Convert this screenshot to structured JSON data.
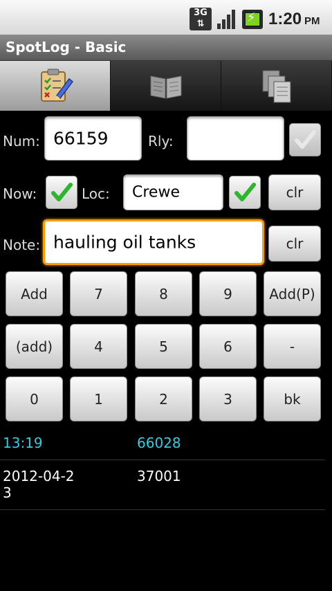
{
  "status_bar": {
    "network": "3G",
    "time": "1:20",
    "ampm": "PM",
    "icons": [
      "3g-data-icon",
      "signal-strength-icon",
      "battery-charging-icon"
    ]
  },
  "app": {
    "title": "SpotLog - Basic"
  },
  "tabs": [
    {
      "name": "tab-checklist",
      "icon": "checklist-pencil-icon",
      "active": true
    },
    {
      "name": "tab-book",
      "icon": "open-book-icon",
      "active": false
    },
    {
      "name": "tab-documents",
      "icon": "documents-icon",
      "active": false
    }
  ],
  "form": {
    "num_label": "Num:",
    "num_value": "66159",
    "rly_label": "Rly:",
    "rly_value": "",
    "rly_checked": false,
    "now_label": "Now:",
    "now_checked": true,
    "loc_label": "Loc:",
    "loc_value": "Crewe",
    "loc_checked": true,
    "loc_clear": "clr",
    "note_label": "Note:",
    "note_value": "hauling oil tanks",
    "note_clear": "clr"
  },
  "keypad": [
    [
      "Add",
      "7",
      "8",
      "9",
      "Add(P)"
    ],
    [
      "(add)",
      "4",
      "5",
      "6",
      "-"
    ],
    [
      "0",
      "1",
      "2",
      "3",
      "bk"
    ]
  ],
  "log": [
    {
      "time": "13:19",
      "number": "66028",
      "highlight": true
    },
    {
      "time": "2012-04-2\n3",
      "number": "37001",
      "highlight": false
    }
  ],
  "colors": {
    "highlight": "#33ccdd",
    "focus": "#ff9a00",
    "check": "#2db52d"
  }
}
